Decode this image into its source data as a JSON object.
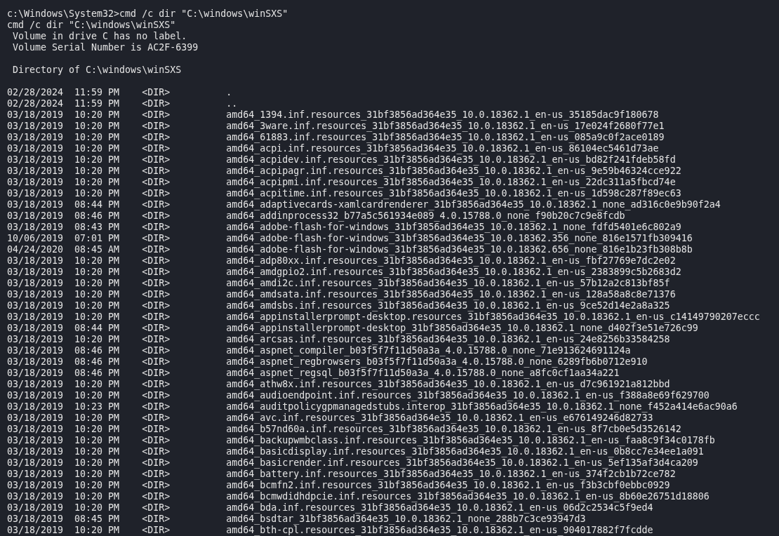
{
  "terminal": {
    "command_line": "c:\\Windows\\System32>cmd /c dir \"C:\\windows\\winSXS\"",
    "output_header": [
      "cmd /c dir \"C:\\windows\\winSXS\"",
      " Volume in drive C has no label.",
      " Volume Serial Number is AC2F-6399"
    ],
    "directory_line": " Directory of C:\\windows\\winSXS",
    "rows": [
      {
        "date": "02/28/2024",
        "time": "11:59 PM",
        "type": "<DIR>",
        "name": "."
      },
      {
        "date": "02/28/2024",
        "time": "11:59 PM",
        "type": "<DIR>",
        "name": ".."
      },
      {
        "date": "03/18/2019",
        "time": "10:20 PM",
        "type": "<DIR>",
        "name": "amd64_1394.inf.resources_31bf3856ad364e35_10.0.18362.1_en-us_35185dac9f180678"
      },
      {
        "date": "03/18/2019",
        "time": "10:20 PM",
        "type": "<DIR>",
        "name": "amd64_3ware.inf.resources_31bf3856ad364e35_10.0.18362.1_en-us_17e024f2680f77e1"
      },
      {
        "date": "03/18/2019",
        "time": "10:20 PM",
        "type": "<DIR>",
        "name": "amd64_61883.inf.resources_31bf3856ad364e35_10.0.18362.1_en-us_085a9c0f2ace0189"
      },
      {
        "date": "03/18/2019",
        "time": "10:20 PM",
        "type": "<DIR>",
        "name": "amd64_acpi.inf.resources_31bf3856ad364e35_10.0.18362.1_en-us_86104ec5461d73ae"
      },
      {
        "date": "03/18/2019",
        "time": "10:20 PM",
        "type": "<DIR>",
        "name": "amd64_acpidev.inf.resources_31bf3856ad364e35_10.0.18362.1_en-us_bd82f241fdeb58fd"
      },
      {
        "date": "03/18/2019",
        "time": "10:20 PM",
        "type": "<DIR>",
        "name": "amd64_acpipagr.inf.resources_31bf3856ad364e35_10.0.18362.1_en-us_9e59b46324cce922"
      },
      {
        "date": "03/18/2019",
        "time": "10:20 PM",
        "type": "<DIR>",
        "name": "amd64_acpipmi.inf.resources_31bf3856ad364e35_10.0.18362.1_en-us_22dc311a5fbcd74e"
      },
      {
        "date": "03/18/2019",
        "time": "10:20 PM",
        "type": "<DIR>",
        "name": "amd64_acpitime.inf.resources_31bf3856ad364e35_10.0.18362.1_en-us_1d598c287f89ec63"
      },
      {
        "date": "03/18/2019",
        "time": "08:44 PM",
        "type": "<DIR>",
        "name": "amd64_adaptivecards-xamlcardrenderer_31bf3856ad364e35_10.0.18362.1_none_ad316c0e9b90f2a4"
      },
      {
        "date": "03/18/2019",
        "time": "08:46 PM",
        "type": "<DIR>",
        "name": "amd64_addinprocess32_b77a5c561934e089_4.0.15788.0_none_f90b20c7c9e8fcdb"
      },
      {
        "date": "03/18/2019",
        "time": "08:43 PM",
        "type": "<DIR>",
        "name": "amd64_adobe-flash-for-windows_31bf3856ad364e35_10.0.18362.1_none_fdfd5401e6c802a9"
      },
      {
        "date": "10/06/2019",
        "time": "07:01 PM",
        "type": "<DIR>",
        "name": "amd64_adobe-flash-for-windows_31bf3856ad364e35_10.0.18362.356_none_816e1571fb309416"
      },
      {
        "date": "04/24/2020",
        "time": "08:45 AM",
        "type": "<DIR>",
        "name": "amd64_adobe-flash-for-windows_31bf3856ad364e35_10.0.18362.656_none_816e1b23fb308b8b"
      },
      {
        "date": "03/18/2019",
        "time": "10:20 PM",
        "type": "<DIR>",
        "name": "amd64_adp80xx.inf.resources_31bf3856ad364e35_10.0.18362.1_en-us_fbf27769e7dc2e02"
      },
      {
        "date": "03/18/2019",
        "time": "10:20 PM",
        "type": "<DIR>",
        "name": "amd64_amdgpio2.inf.resources_31bf3856ad364e35_10.0.18362.1_en-us_2383899c5b2683d2"
      },
      {
        "date": "03/18/2019",
        "time": "10:20 PM",
        "type": "<DIR>",
        "name": "amd64_amdi2c.inf.resources_31bf3856ad364e35_10.0.18362.1_en-us_57b12a2c813bf85f"
      },
      {
        "date": "03/18/2019",
        "time": "10:20 PM",
        "type": "<DIR>",
        "name": "amd64_amdsata.inf.resources_31bf3856ad364e35_10.0.18362.1_en-us_128a58a8c8e71376"
      },
      {
        "date": "03/18/2019",
        "time": "10:20 PM",
        "type": "<DIR>",
        "name": "amd64_amdsbs.inf.resources_31bf3856ad364e35_10.0.18362.1_en-us_9ce52d14e2a8a325"
      },
      {
        "date": "03/18/2019",
        "time": "10:20 PM",
        "type": "<DIR>",
        "name": "amd64_appinstallerprompt-desktop.resources_31bf3856ad364e35_10.0.18362.1_en-us_c14149790207eccc"
      },
      {
        "date": "03/18/2019",
        "time": "08:44 PM",
        "type": "<DIR>",
        "name": "amd64_appinstallerprompt-desktop_31bf3856ad364e35_10.0.18362.1_none_d402f3e51e726c99"
      },
      {
        "date": "03/18/2019",
        "time": "10:20 PM",
        "type": "<DIR>",
        "name": "amd64_arcsas.inf.resources_31bf3856ad364e35_10.0.18362.1_en-us_24e8256b33584258"
      },
      {
        "date": "03/18/2019",
        "time": "08:46 PM",
        "type": "<DIR>",
        "name": "amd64_aspnet_compiler_b03f5f7f11d50a3a_4.0.15788.0_none_71e913624691124a"
      },
      {
        "date": "03/18/2019",
        "time": "08:46 PM",
        "type": "<DIR>",
        "name": "amd64_aspnet_regbrowsers_b03f5f7f11d50a3a_4.0.15788.0_none_6289fb6b0712e910"
      },
      {
        "date": "03/18/2019",
        "time": "08:46 PM",
        "type": "<DIR>",
        "name": "amd64_aspnet_regsql_b03f5f7f11d50a3a_4.0.15788.0_none_a8fc0cf1aa34a221"
      },
      {
        "date": "03/18/2019",
        "time": "10:20 PM",
        "type": "<DIR>",
        "name": "amd64_athw8x.inf.resources_31bf3856ad364e35_10.0.18362.1_en-us_d7c961921a812bbd"
      },
      {
        "date": "03/18/2019",
        "time": "10:20 PM",
        "type": "<DIR>",
        "name": "amd64_audioendpoint.inf.resources_31bf3856ad364e35_10.0.18362.1_en-us_f388a8e69f629700"
      },
      {
        "date": "03/18/2019",
        "time": "10:23 PM",
        "type": "<DIR>",
        "name": "amd64_auditpolicygpmanagedstubs.interop_31bf3856ad364e35_10.0.18362.1_none_f452a414e6ac90a6"
      },
      {
        "date": "03/18/2019",
        "time": "10:20 PM",
        "type": "<DIR>",
        "name": "amd64_avc.inf.resources_31bf3856ad364e35_10.0.18362.1_en-us_e676149246d82733"
      },
      {
        "date": "03/18/2019",
        "time": "10:20 PM",
        "type": "<DIR>",
        "name": "amd64_b57nd60a.inf.resources_31bf3856ad364e35_10.0.18362.1_en-us_8f7cb0e5d3526142"
      },
      {
        "date": "03/18/2019",
        "time": "10:20 PM",
        "type": "<DIR>",
        "name": "amd64_backupwmbclass.inf.resources_31bf3856ad364e35_10.0.18362.1_en-us_faa8c9f34c0178fb"
      },
      {
        "date": "03/18/2019",
        "time": "10:20 PM",
        "type": "<DIR>",
        "name": "amd64_basicdisplay.inf.resources_31bf3856ad364e35_10.0.18362.1_en-us_0b8cc7e34ee1a091"
      },
      {
        "date": "03/18/2019",
        "time": "10:20 PM",
        "type": "<DIR>",
        "name": "amd64_basicrender.inf.resources_31bf3856ad364e35_10.0.18362.1_en-us_5ef135af3d4ca209"
      },
      {
        "date": "03/18/2019",
        "time": "10:20 PM",
        "type": "<DIR>",
        "name": "amd64_battery.inf.resources_31bf3856ad364e35_10.0.18362.1_en-us_374f2cb1b72ce782"
      },
      {
        "date": "03/18/2019",
        "time": "10:20 PM",
        "type": "<DIR>",
        "name": "amd64_bcmfn2.inf.resources_31bf3856ad364e35_10.0.18362.1_en-us_f3b3cbf0ebbc0929"
      },
      {
        "date": "03/18/2019",
        "time": "10:20 PM",
        "type": "<DIR>",
        "name": "amd64_bcmwdidhdpcie.inf.resources_31bf3856ad364e35_10.0.18362.1_en-us_8b60e26751d18806"
      },
      {
        "date": "03/18/2019",
        "time": "10:20 PM",
        "type": "<DIR>",
        "name": "amd64_bda.inf.resources_31bf3856ad364e35_10.0.18362.1_en-us_06d2c2534c5f9ed4"
      },
      {
        "date": "03/18/2019",
        "time": "08:45 PM",
        "type": "<DIR>",
        "name": "amd64_bsdtar_31bf3856ad364e35_10.0.18362.1_none_288b7c3ce93947d3"
      },
      {
        "date": "03/18/2019",
        "time": "10:20 PM",
        "type": "<DIR>",
        "name": "amd64_bth-cpl.resources_31bf3856ad364e35_10.0.18362.1_en-us_904017882f7fcdde"
      }
    ]
  }
}
